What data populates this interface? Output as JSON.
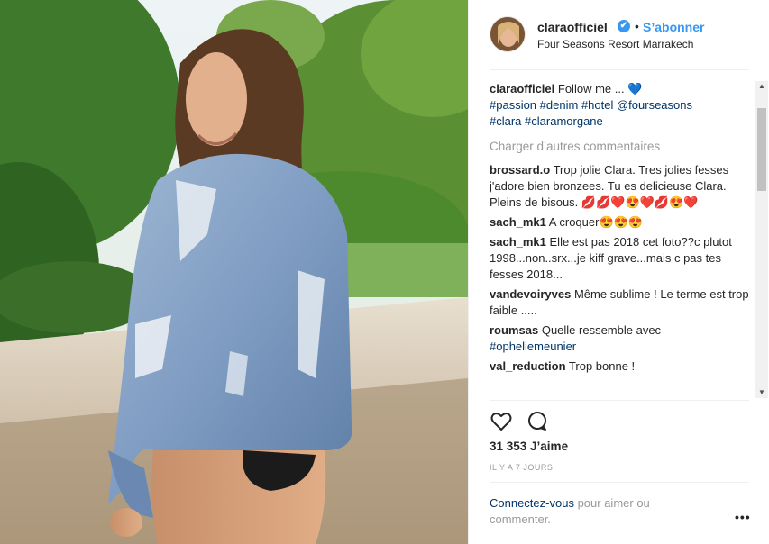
{
  "post": {
    "username": "claraofficiel",
    "dot": "•",
    "follow_label": "S’abonner",
    "location": "Four Seasons Resort Marrakech",
    "verified_icon": "✔"
  },
  "caption": {
    "username": "claraofficiel",
    "text": "Follow me ...",
    "emoji": "💙",
    "hashtags": [
      "#passion",
      "#denim",
      "#hotel",
      "@fourseasons",
      "#clara",
      "#claramorgane"
    ]
  },
  "load_more_label": "Charger d’autres commentaires",
  "comments": [
    {
      "user": "brossard.o",
      "text": "Trop jolie Clara. Tres jolies fesses j'adore bien bronzees. Tu es delicieuse Clara. Pleins de bisous. 💋💋❤️😍❤️💋😍❤️"
    },
    {
      "user": "sach_mk1",
      "text": "A croquer😍😍😍"
    },
    {
      "user": "sach_mk1",
      "text": "Elle est pas 2018 cet foto??c plutot 1998...non..srx...je kiff grave...mais c pas tes fesses 2018..."
    },
    {
      "user": "vandevoiryves",
      "text": "Même sublime ! Le terme est trop faible ....."
    },
    {
      "user": "roumsas",
      "text": "Quelle ressemble avec",
      "tag": "#opheliemeunier"
    },
    {
      "user": "val_reduction",
      "text": "Trop bonne !"
    }
  ],
  "likes": "31 353 J’aime",
  "timestamp": "IL Y A 7 JOURS",
  "login_prompt": {
    "link": "Connectez-vous",
    "text": " pour aimer ou commenter."
  },
  "more_label": "•••",
  "scroll": {
    "up": "▲",
    "down": "▼"
  },
  "icons": {
    "like": "heart-icon",
    "comment": "comment-bubble-icon"
  }
}
